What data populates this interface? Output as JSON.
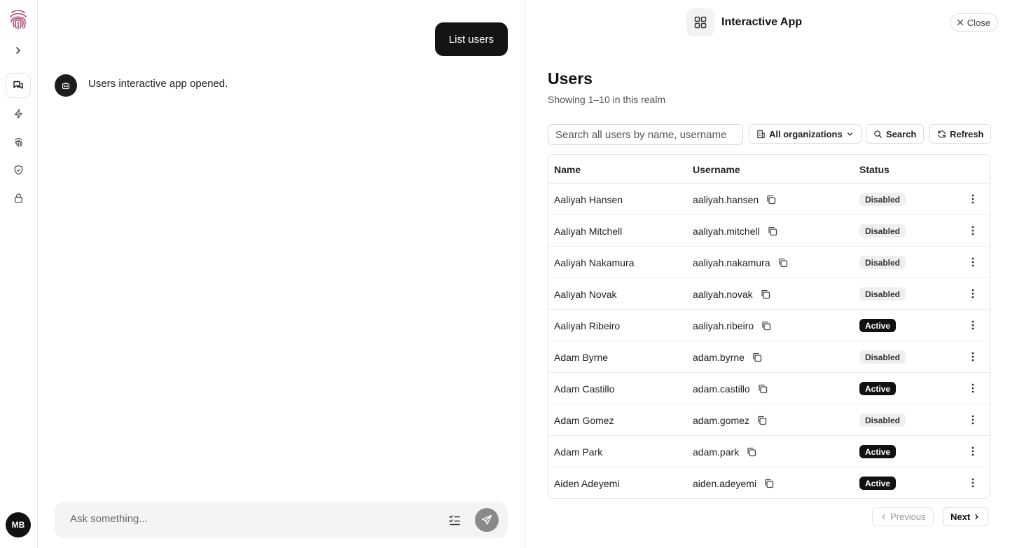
{
  "sidebar": {
    "icons": [
      "fingerprint-logo",
      "chevron-right-icon",
      "chat-icon",
      "lightning-icon",
      "fingerprint-icon",
      "shield-check-icon",
      "lock-icon"
    ],
    "avatar_initials": "MB"
  },
  "chat": {
    "user_message": "List users",
    "bot_message": "Users interactive app opened.",
    "composer_placeholder": "Ask something..."
  },
  "panel": {
    "app_title": "Interactive App",
    "close_label": "Close",
    "heading": "Users",
    "subheading": "Showing 1–10 in this realm",
    "search_placeholder": "Search all users by name, username",
    "org_filter": "All organizations",
    "search_label": "Search",
    "refresh_label": "Refresh",
    "columns": [
      "Name",
      "Username",
      "Status"
    ],
    "rows": [
      {
        "name": "Aaliyah Hansen",
        "username": "aaliyah.hansen",
        "status": "Disabled"
      },
      {
        "name": "Aaliyah Mitchell",
        "username": "aaliyah.mitchell",
        "status": "Disabled"
      },
      {
        "name": "Aaliyah Nakamura",
        "username": "aaliyah.nakamura",
        "status": "Disabled"
      },
      {
        "name": "Aaliyah Novak",
        "username": "aaliyah.novak",
        "status": "Disabled"
      },
      {
        "name": "Aaliyah Ribeiro",
        "username": "aaliyah.ribeiro",
        "status": "Active"
      },
      {
        "name": "Adam Byrne",
        "username": "adam.byrne",
        "status": "Disabled"
      },
      {
        "name": "Adam Castillo",
        "username": "adam.castillo",
        "status": "Active"
      },
      {
        "name": "Adam Gomez",
        "username": "adam.gomez",
        "status": "Disabled"
      },
      {
        "name": "Adam Park",
        "username": "adam.park",
        "status": "Active"
      },
      {
        "name": "Aiden Adeyemi",
        "username": "aiden.adeyemi",
        "status": "Active"
      }
    ],
    "previous_label": "Previous",
    "next_label": "Next"
  },
  "colors": {
    "brand": "#b0467a",
    "active_badge": "#111111",
    "disabled_badge": "#efefef"
  }
}
